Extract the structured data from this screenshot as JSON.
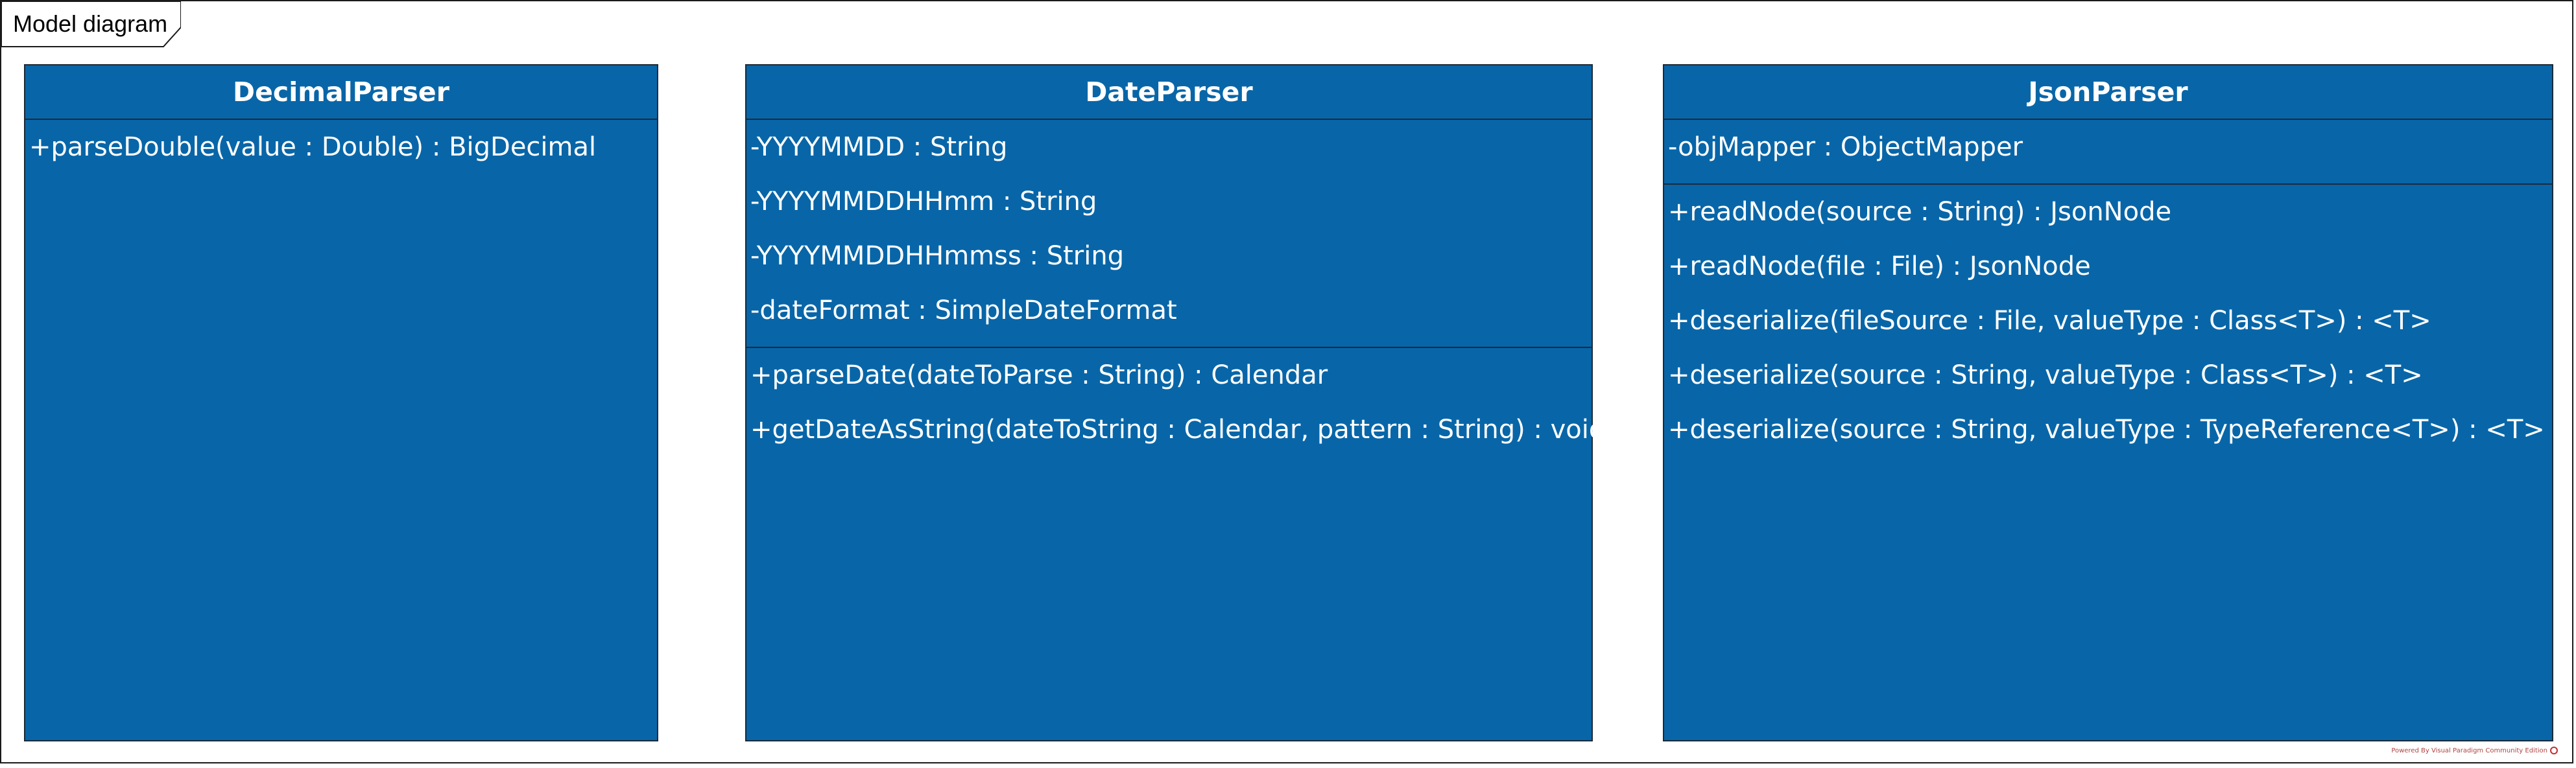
{
  "frame": {
    "label": "Model diagram"
  },
  "colors": {
    "class_fill": "#0866a8",
    "class_border": "#1a2a38",
    "text": "#ffffff",
    "frame_border": "#1a1a1a"
  },
  "classes": [
    {
      "name": "DecimalParser",
      "attributes": [],
      "operations": [
        "+parseDouble(value : Double) : BigDecimal"
      ]
    },
    {
      "name": "DateParser",
      "attributes": [
        "-YYYYMMDD : String",
        "-YYYYMMDDHHmm : String",
        "-YYYYMMDDHHmmss : String",
        "-dateFormat : SimpleDateFormat"
      ],
      "operations": [
        "+parseDate(dateToParse : String) : Calendar",
        "+getDateAsString(dateToString : Calendar, pattern : String) : void"
      ]
    },
    {
      "name": "JsonParser",
      "attributes": [
        "-objMapper : ObjectMapper"
      ],
      "operations": [
        "+readNode(source : String) : JsonNode",
        "+readNode(file : File) : JsonNode",
        "+deserialize(fileSource : File, valueType : Class<T>) : <T>",
        "+deserialize(source : String, valueType : Class<T>) : <T>",
        "+deserialize(source : String, valueType : TypeReference<T>) : <T>"
      ]
    }
  ],
  "watermark": {
    "text": "Powered By Visual Paradigm Community Edition"
  }
}
